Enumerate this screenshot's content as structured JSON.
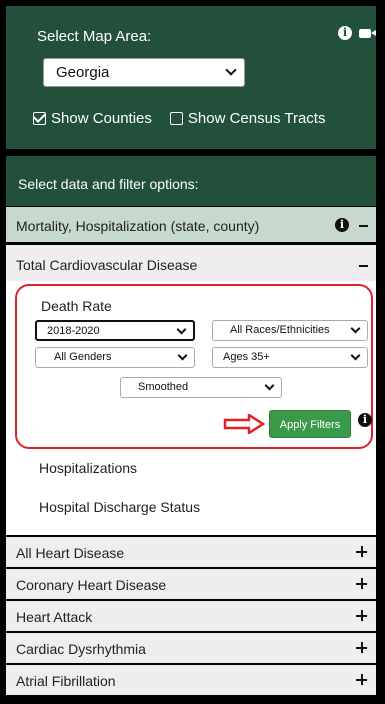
{
  "map_area": {
    "title": "Select Map Area:",
    "icons": [
      "info-icon",
      "video-icon"
    ],
    "state_select_value": "Georgia",
    "show_counties_label": "Show Counties",
    "show_counties_checked": true,
    "show_tracts_label": "Show Census Tracts",
    "show_tracts_checked": false
  },
  "filters": {
    "header": "Select data and filter options:",
    "category": "Mortality, Hospitalization (state, county)",
    "subcategory": "Total Cardiovascular Disease",
    "measure": "Death Rate",
    "year_value": "2018-2020",
    "race_value": "All Races/Ethnicities",
    "gender_value": "All Genders",
    "age_value": "Ages 35+",
    "smoothing_value": "Smoothed",
    "apply_label": "Apply Filters",
    "other_measures": [
      "Hospitalizations",
      "Hospital Discharge Status"
    ]
  },
  "accordion": [
    "All Heart Disease",
    "Coronary Heart Disease",
    "Heart Attack",
    "Cardiac Dysrhythmia",
    "Atrial Fibrillation"
  ],
  "colors": {
    "header_green": "#23503a",
    "highlight_red": "#e0232b",
    "apply_green": "#3a9a4a"
  }
}
